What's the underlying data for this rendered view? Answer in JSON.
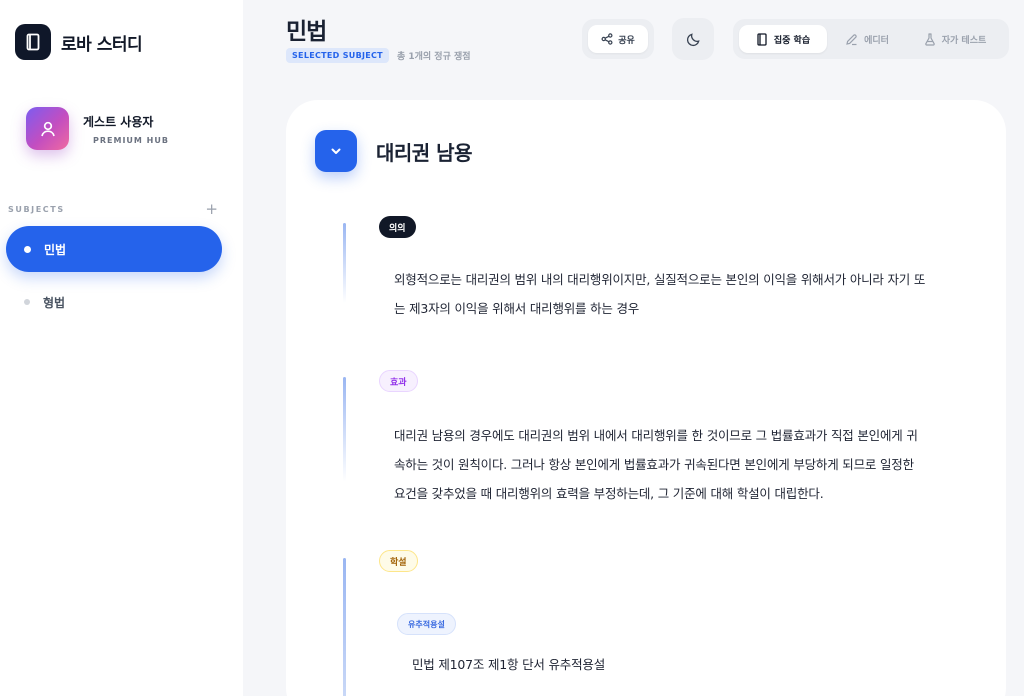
{
  "app": {
    "name": "로바 스터디"
  },
  "user": {
    "name": "게스트 사용자",
    "tier": "PREMIUM HUB"
  },
  "sidebar": {
    "section_label": "SUBJECTS",
    "add_label": "+",
    "items": [
      {
        "label": "민법",
        "active": true
      },
      {
        "label": "형법",
        "active": false
      }
    ]
  },
  "header": {
    "title": "민법",
    "badge": "SELECTED SUBJECT",
    "count_text": "총 1개의 정규 쟁점",
    "share_label": "공유",
    "modes": [
      {
        "label": "집중 학습",
        "icon": "book-icon",
        "active": true
      },
      {
        "label": "에디터",
        "icon": "pencil-icon",
        "active": false
      },
      {
        "label": "자가 테스트",
        "icon": "flask-icon",
        "active": false
      }
    ]
  },
  "issue": {
    "title": "대리권 남용",
    "sections": [
      {
        "tag": "의의",
        "lines": [
          "외형적으로는 대리권의 범위 내의 대리행위이지만, 실질적으로는 본인의 이익을 위해서가 아니라 자기 또",
          "는 제3자의 이익을 위해서 대리행위를 하는 경우"
        ]
      },
      {
        "tag": "효과",
        "lines": [
          "대리권 남용의 경우에도 대리권의 범위 내에서 대리행위를 한 것이므로 그 법률효과가 직접 본인에게 귀",
          "속하는 것이 원칙이다. 그러나 항상 본인에게 법률효과가 귀속된다면 본인에게 부당하게 되므로 일정한",
          "요건을 갖추었을 때 대리행위의 효력을 부정하는데, 그 기준에 대해 학설이 대립한다."
        ]
      },
      {
        "tag": "학설",
        "subtag": "유추적용설",
        "lines": [
          "민법 제107조 제1항 단서 유추적용설"
        ]
      }
    ]
  },
  "colors": {
    "accent": "#2563eb",
    "dark": "#0f1729",
    "tag_effect": "#9333ea",
    "tag_theory": "#a16207"
  }
}
